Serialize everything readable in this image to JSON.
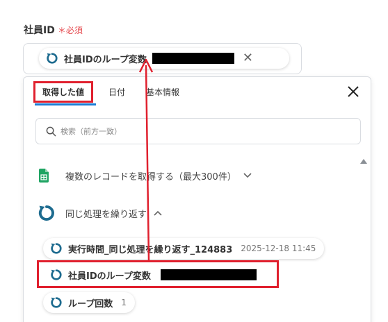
{
  "field": {
    "label": "社員ID",
    "required_mark": "＊必須",
    "chip_label": "社員IDのループ変数"
  },
  "panel": {
    "tabs": [
      {
        "label": "取得した値"
      },
      {
        "label": "日付"
      },
      {
        "label": "基本情報"
      }
    ],
    "search_placeholder": "検索（前方一致）",
    "sections": [
      {
        "title": "複数のレコードを取得する（最大300件）"
      },
      {
        "title": "同じ処理を繰り返す"
      }
    ],
    "items": [
      {
        "label": "実行時間_同じ処理を繰り返す_124883",
        "meta": "2025-12-18 11:45"
      },
      {
        "label": "社員IDのループ変数"
      },
      {
        "label": "ループ回数",
        "meta": "1"
      }
    ]
  },
  "colors": {
    "accent": "#1a7bd4",
    "highlight": "#e0202e",
    "loop_icon": "#1d6b8f",
    "sheets_icon": "#1fa463",
    "required": "#e5484d"
  }
}
